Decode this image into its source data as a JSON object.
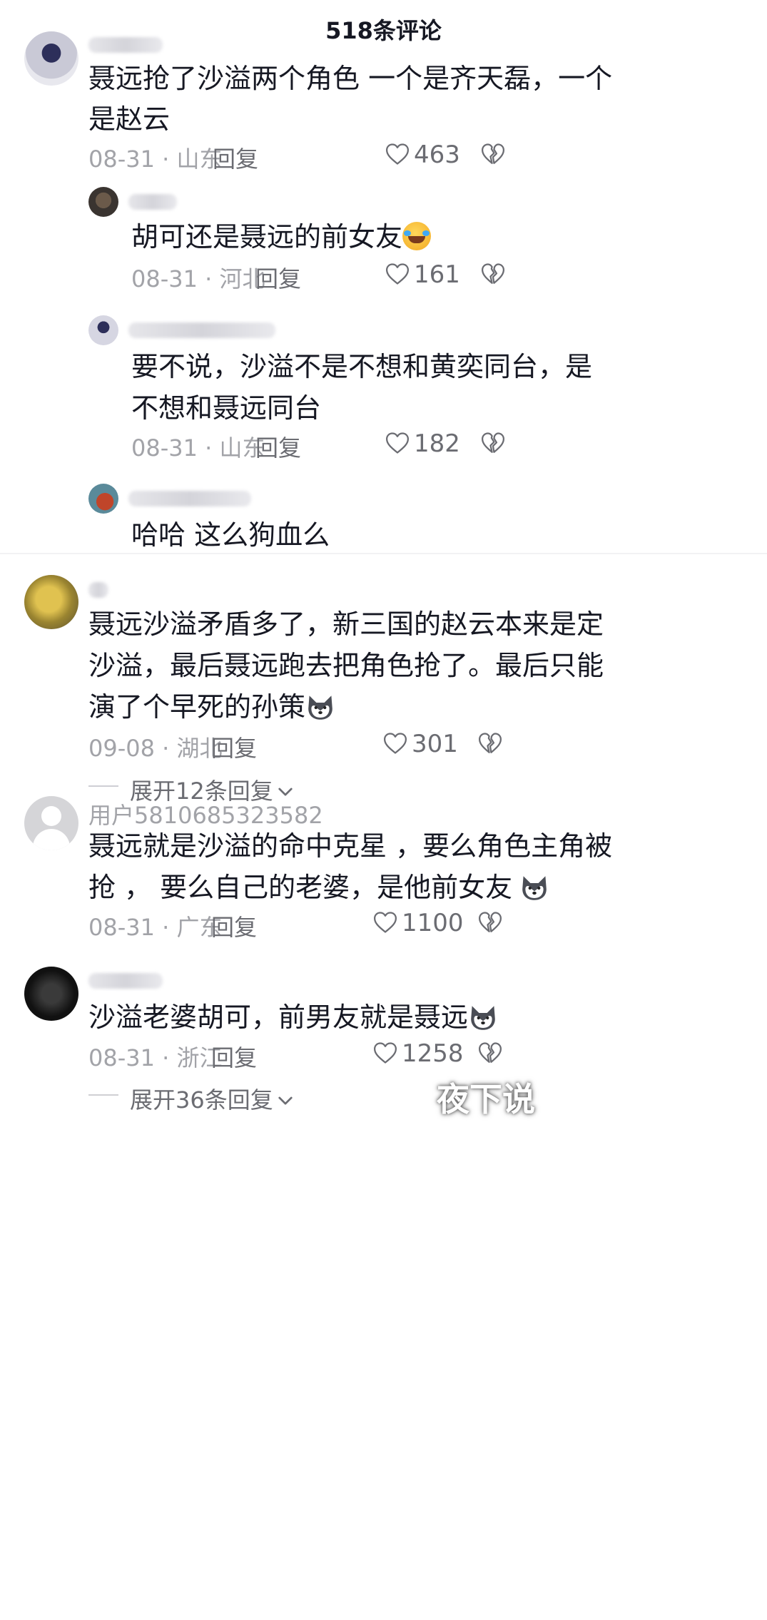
{
  "header": {
    "title": "518条评论"
  },
  "comments": [
    {
      "text_lines": [
        "聂远抢了沙溢两个角色  一个是齐天磊，一个",
        "是赵云"
      ],
      "date": "08-31 · 山东",
      "reply": "回复",
      "likes": "463"
    },
    {
      "text_lines": [
        "胡可还是聂远的前女友"
      ],
      "date": "08-31 · 河北",
      "reply": "回复",
      "likes": "161"
    },
    {
      "text_lines": [
        "要不说，沙溢不是不想和黄奕同台，是",
        "不想和聂远同台"
      ],
      "date": "08-31 · 山东",
      "reply": "回复",
      "likes": "182"
    },
    {
      "text_lines": [
        "哈哈 这么狗血么"
      ]
    },
    {
      "text_lines": [
        "聂远沙溢矛盾多了，新三国的赵云本来是定",
        "沙溢，最后聂远跑去把角色抢了。最后只能",
        "演了个早死的孙策"
      ],
      "date": "09-08 · 湖北",
      "reply": "回复",
      "likes": "301",
      "expand": "展开12条回复"
    },
    {
      "username": "用户5810685323582",
      "text_lines": [
        "聂远就是沙溢的命中克星 ，要么角色主角被",
        "抢 ，  要么自己的老婆，是他前女友"
      ],
      "date": "08-31 · 广东",
      "reply": "回复",
      "likes": "1100"
    },
    {
      "text_lines": [
        "沙溢老婆胡可，前男友就是聂远"
      ],
      "date": "08-31 · 浙江",
      "reply": "回复",
      "likes": "1258",
      "expand": "展开36条回复"
    }
  ],
  "icons": {
    "like": "heart-outline-icon",
    "dislike": "broken-heart-icon",
    "chevron": "chevron-down-icon",
    "emoji_laugh": "laughing-crying-emoji",
    "emoji_dog": "husky-dog-emoji"
  },
  "watermark": "夜下说"
}
